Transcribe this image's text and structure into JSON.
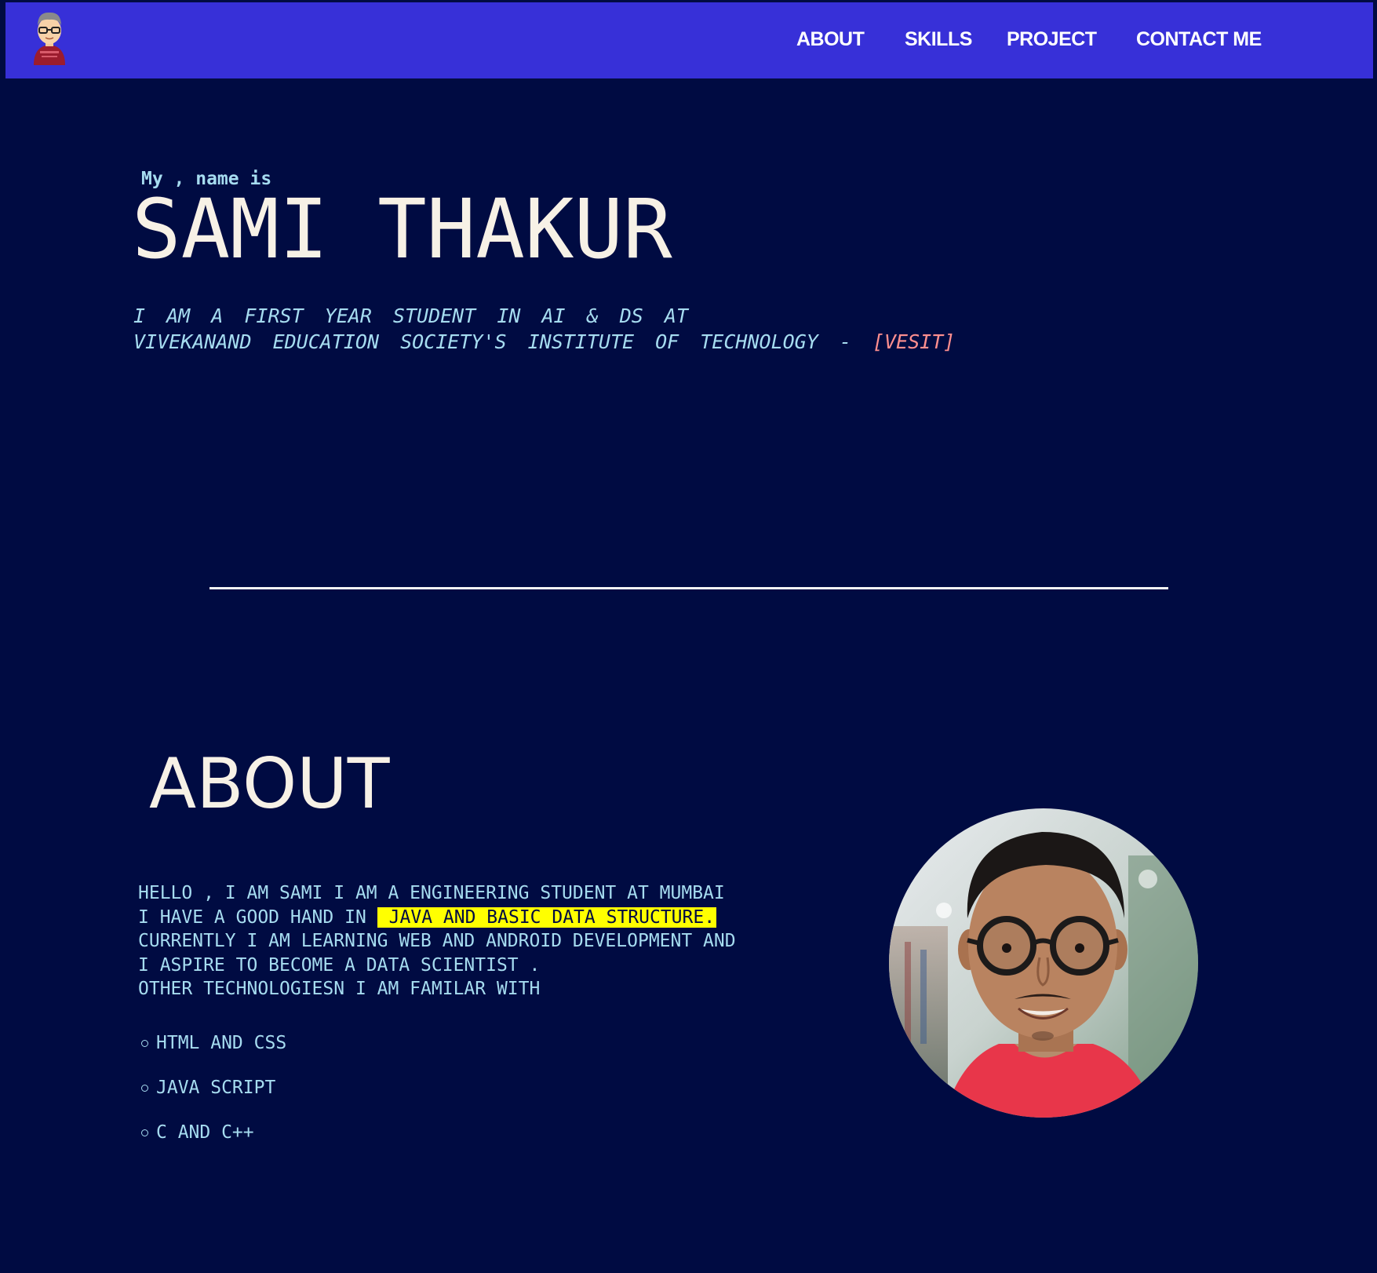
{
  "nav": {
    "logo_icon": "developer-avatar-icon",
    "links": [
      {
        "label": "ABOUT"
      },
      {
        "label": "SKILLS"
      },
      {
        "label": "PROJECT"
      },
      {
        "label": "CONTACT ME"
      }
    ]
  },
  "hero": {
    "intro": "My , name is",
    "name": "SAMI THAKUR",
    "subtitle_line1": "I AM A FIRST YEAR STUDENT IN AI & DS AT",
    "subtitle_line2": "VIVEKANAND EDUCATION SOCIETY'S INSTITUTE OF TECHNOLOGY -",
    "subtitle_accent": "[VESIT]"
  },
  "about": {
    "title": "ABOUT",
    "line1": "HELLO , I AM SAMI I AM A ENGINEERING STUDENT AT MUMBAI",
    "line2_prefix": "I HAVE A GOOD HAND IN",
    "line2_highlight": "JAVA AND BASIC DATA STRUCTURE.",
    "line3": "CURRENTLY I AM LEARNING WEB AND ANDROID DEVELOPMENT AND",
    "line4": "I ASPIRE TO BECOME A DATA SCIENTIST .",
    "line5": "OTHER TECHNOLOGIESN I AM FAMILAR WITH",
    "skills": [
      "HTML AND CSS",
      "JAVA SCRIPT",
      "C AND C++"
    ],
    "photo_icon": "profile-photo"
  },
  "colors": {
    "background": "#000b42",
    "navbar": "#3730d8",
    "text_light": "#a6dcf0",
    "heading": "#f7f1e6",
    "accent": "#ff8f8f",
    "highlight": "#ffff00"
  }
}
